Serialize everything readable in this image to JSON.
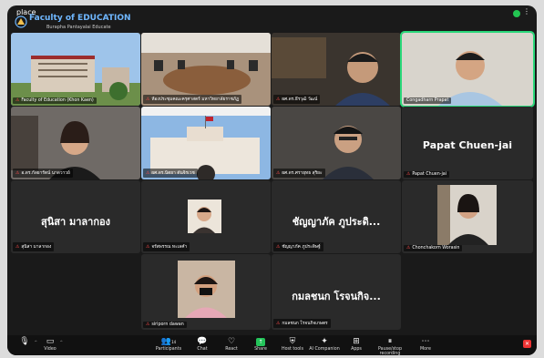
{
  "window": {
    "title": "place",
    "more": "⋮"
  },
  "logo": {
    "line1": "Faculty of EDUCATION",
    "line2": "Burapha Pantayalai Educate"
  },
  "tiles": [
    {
      "name": "Faculty of Education (Khon Kaen)",
      "type": "building"
    },
    {
      "name": "ห้องประชุมคณะครุศาสตร์ มหาวิทยาลัยราชภัฏ",
      "type": "meeting-room"
    },
    {
      "name": "ผศ.ดร.ธีรวุฒิ วัฒน์",
      "type": "person"
    },
    {
      "name": "Congadharn Prapat",
      "type": "person",
      "active": true
    },
    {
      "name": "อ.ดร.กัลยารัตน์ นาดวาวย์",
      "type": "person"
    },
    {
      "name": "ผศ.ดร.นิตยา ตันจิรเวช",
      "type": "building-flag"
    },
    {
      "name": "ผศ.ดร.ศรายุทธ สุริยะ",
      "type": "person"
    },
    {
      "name": "Papat Chuen-jai",
      "type": "name-only",
      "label": "Papat Chuen-jai"
    },
    {
      "name": "สุนิสา มาลากอง",
      "type": "name-only",
      "label": "สุนิสา มาลากอง"
    },
    {
      "name": "จรัสพรรณ ทะเลคำ",
      "type": "small-cam"
    },
    {
      "name": "ชัญญาภัค ภูประดิษฐ์",
      "type": "name-only",
      "label": "ชัญญาภัค ภูประดิ..."
    },
    {
      "name": "Chonchakorn Worasin",
      "type": "person"
    },
    {
      "name": "siriporn dawan",
      "type": "small-cam"
    },
    {
      "name": "กมลชนก โรจนกิจเกษตร",
      "type": "name-only",
      "label": "กมลชนก โรจนกิจ..."
    }
  ],
  "toolbar": {
    "mic": "",
    "video": "Video",
    "participants": "Participants",
    "participants_count": "14",
    "chat": "Chat",
    "react": "React",
    "share": "Share",
    "host_tools": "Host tools",
    "ai": "AI Companion",
    "apps": "Apps",
    "record": "Pause/stop recording",
    "more": "More"
  },
  "colors": {
    "active_border": "#2ad87a",
    "share": "#24c35a",
    "end": "#ee3333",
    "muted": "#ff4b4b"
  }
}
